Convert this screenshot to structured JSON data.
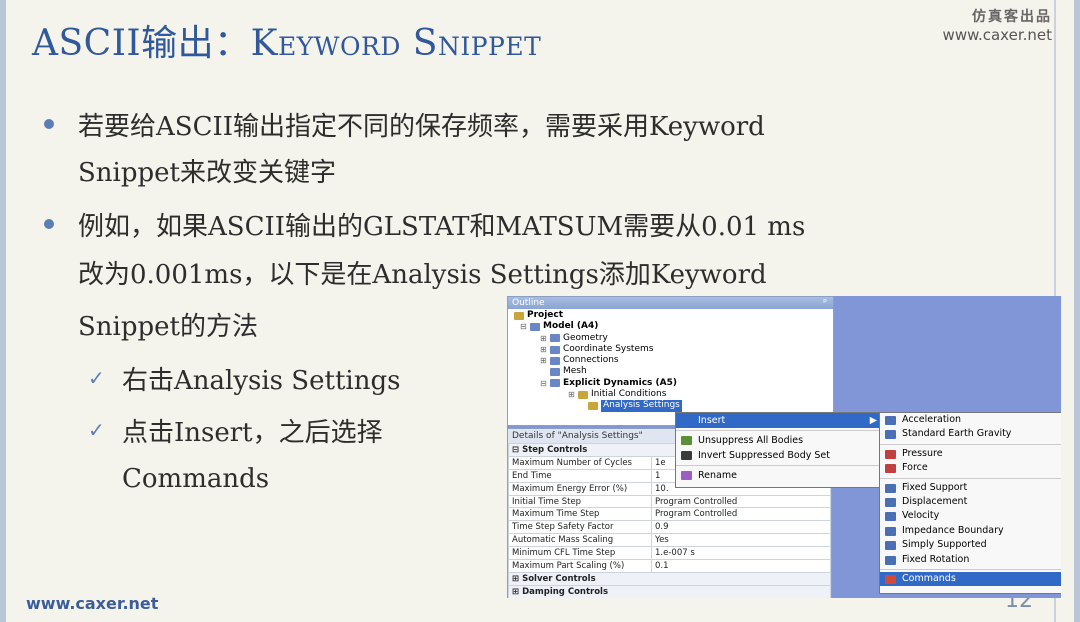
{
  "slide": {
    "title_prefix": "ASCII输出：",
    "title_rest": "Keyword Snippet",
    "brand_cn": "仿真客出品",
    "brand_url": "www.caxer.net",
    "footer": "www.caxer.net",
    "page": "12"
  },
  "bullets": {
    "b1_l1": "若要给ASCII输出指定不同的保存频率，需要采用Keyword",
    "b1_l2": "Snippet来改变关键字",
    "b2_l1": "例如，如果ASCII输出的GLSTAT和MATSUM需要从0.01 ms",
    "b2_l2": "改为0.001ms，以下是在Analysis Settings添加Keyword",
    "b2_l3": "Snippet的方法",
    "check": "✓",
    "s1": "右击Analysis Settings",
    "s2_l1": "点击Insert，之后选择",
    "s2_l2": "Commands"
  },
  "outline": {
    "header": "Outline",
    "pin": "ᵖ",
    "tree": [
      "Project",
      "Model (A4)",
      "Geometry",
      "Coordinate Systems",
      "Connections",
      "Mesh",
      "Explicit Dynamics (A5)",
      "Initial Conditions",
      "Analysis Settings"
    ]
  },
  "details": {
    "header": "Details of \"Analysis Settings\"",
    "groups": {
      "step": "Step Controls",
      "solver": "Solver Controls",
      "damping": "Damping Controls"
    },
    "rows": [
      [
        "Maximum Number of Cycles",
        "1e"
      ],
      [
        "End Time",
        "1"
      ],
      [
        "Maximum Energy Error (%)",
        "10."
      ],
      [
        "Initial Time Step",
        "Program Controlled"
      ],
      [
        "Maximum Time Step",
        "Program Controlled"
      ],
      [
        "Time Step Safety Factor",
        "0.9"
      ],
      [
        "Automatic Mass Scaling",
        "Yes"
      ],
      [
        "Minimum CFL Time Step",
        "1.e-007 s"
      ],
      [
        "Maximum Part Scaling (%)",
        "0.1"
      ]
    ]
  },
  "context_menu": {
    "insert": "Insert",
    "unsuppress": "Unsuppress All Bodies",
    "invert": "Invert Suppressed Body Set",
    "rename": "Rename",
    "arrow": "▶"
  },
  "insert_menu": [
    "Acceleration",
    "Standard Earth Gravity",
    "Pressure",
    "Force",
    "Fixed Support",
    "Displacement",
    "Velocity",
    "Impedance Boundary",
    "Simply Supported",
    "Fixed Rotation",
    "Commands"
  ],
  "colors": {
    "title": "#31589b",
    "highlight": "#3169c6",
    "bullet": "#5b7fb3"
  }
}
